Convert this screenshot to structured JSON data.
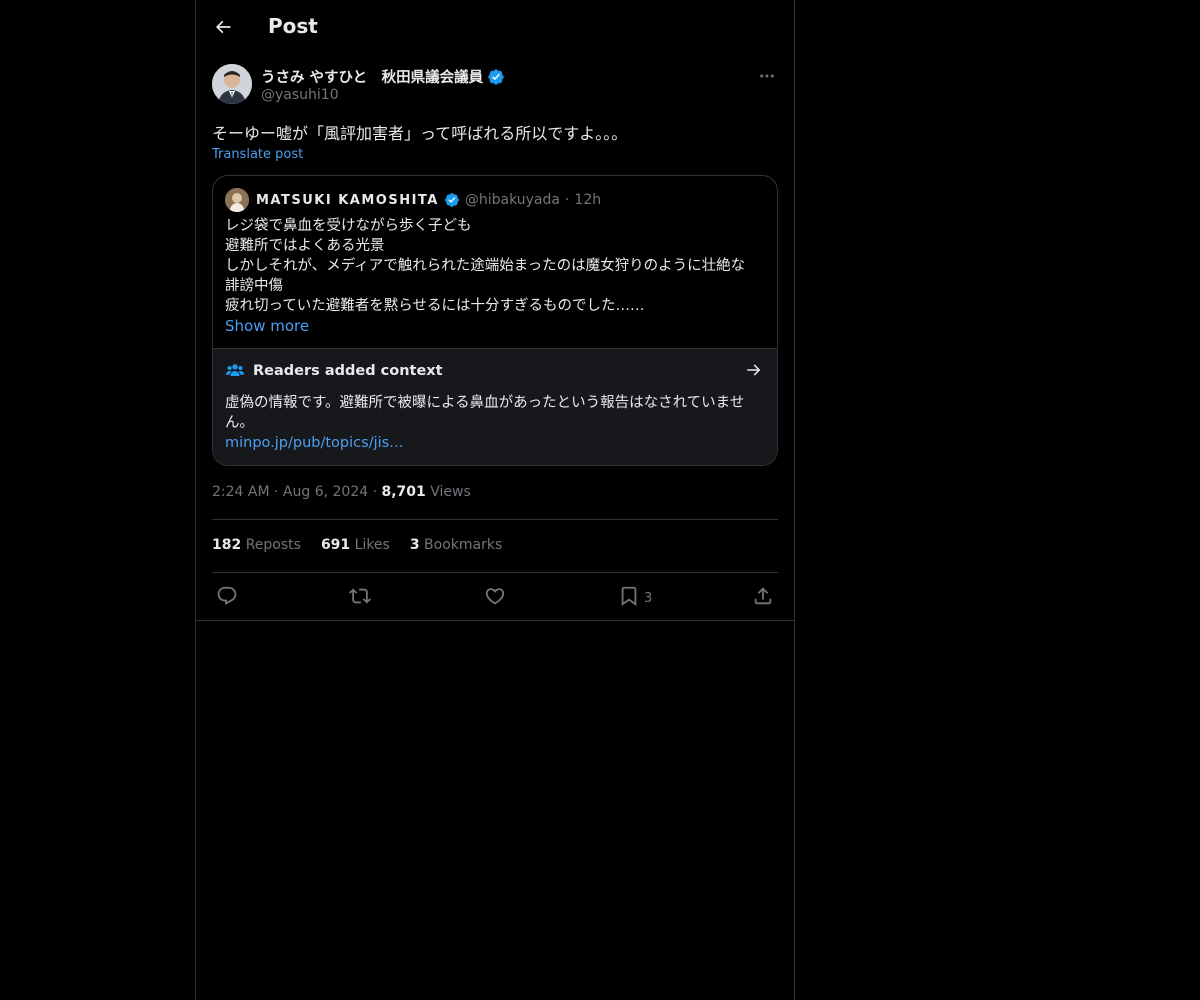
{
  "header": {
    "title": "Post",
    "back_icon": "arrow-left-icon"
  },
  "post": {
    "author_name": "うさみ やすひと　秋田県議会議員",
    "author_handle": "@yasuhi10",
    "verified": true,
    "text": "そーゆー嘘が「風評加害者」って呼ばれる所以ですよ。。。",
    "translate_label": "Translate post",
    "quote": {
      "name": "MATSUKI KAMOSHITA",
      "handle": "@hibakuyada",
      "separator": "·",
      "time": "12h",
      "lines": [
        "レジ袋で鼻血を受けながら歩く子ども",
        "避難所ではよくある光景",
        "しかしそれが、メディアで触れられた途端始まったのは魔女狩りのように壮絶な",
        "誹謗中傷",
        "疲れ切っていた避難者を黙らせるには十分すぎるものでした……"
      ],
      "show_more": "Show more",
      "context": {
        "title": "Readers added context",
        "text": "虚偽の情報です。避難所で被曝による鼻血があったという報告はなされていません。",
        "link": "minpo.jp/pub/topics/jis…"
      }
    },
    "meta": {
      "time": "2:24 AM",
      "sep1": "·",
      "date": "Aug 6, 2024",
      "sep2": "·",
      "views_count": "8,701",
      "views_label": "Views"
    },
    "stats": {
      "reposts_count": "182",
      "reposts_label": "Reposts",
      "likes_count": "691",
      "likes_label": "Likes",
      "bookmarks_count": "3",
      "bookmarks_label": "Bookmarks"
    },
    "actions": {
      "bookmark_count": "3"
    }
  },
  "colors": {
    "background": "#000000",
    "text": "#e7e9ea",
    "muted": "#71767b",
    "accent": "#1d9bf0",
    "link": "#4c9ff0",
    "border": "#2f3336",
    "context_bg": "#16181c"
  }
}
